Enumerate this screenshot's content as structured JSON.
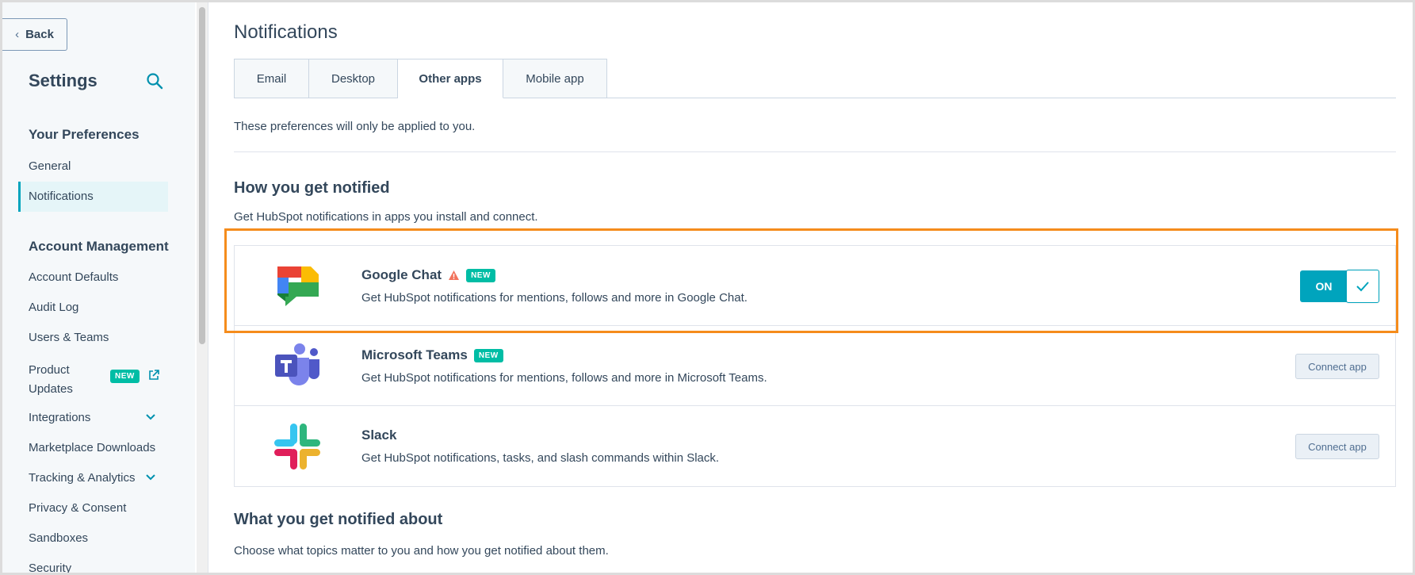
{
  "sidebar": {
    "back_label": "Back",
    "title": "Settings",
    "sections": [
      {
        "heading": "Your Preferences",
        "items": [
          "General",
          "Notifications"
        ]
      },
      {
        "heading": "Account Management",
        "items": [
          "Account Defaults",
          "Audit Log",
          "Users & Teams",
          "Product Updates",
          "Integrations",
          "Marketplace Downloads",
          "Tracking & Analytics",
          "Privacy & Consent",
          "Sandboxes",
          "Security"
        ]
      }
    ],
    "product_updates_line1": "Product",
    "product_updates_line2": "Updates",
    "new_badge": "NEW",
    "active_item": "Notifications"
  },
  "main": {
    "title": "Notifications",
    "tabs": [
      {
        "label": "Email"
      },
      {
        "label": "Desktop"
      },
      {
        "label": "Other apps",
        "active": true
      },
      {
        "label": "Mobile app"
      }
    ],
    "pref_note": "These preferences will only be applied to you.",
    "how_heading": "How you get notified",
    "how_sub": "Get HubSpot notifications in apps you install and connect.",
    "apps": [
      {
        "name": "Google Chat",
        "badge": "NEW",
        "warning": true,
        "desc": "Get HubSpot notifications for mentions, follows and more in Google Chat.",
        "state": "ON"
      },
      {
        "name": "Microsoft Teams",
        "badge": "NEW",
        "desc": "Get HubSpot notifications for mentions, follows and more in Microsoft Teams.",
        "action": "Connect app"
      },
      {
        "name": "Slack",
        "desc": "Get HubSpot notifications, tasks, and slash commands within Slack.",
        "action": "Connect app"
      }
    ],
    "what_heading": "What you get notified about",
    "what_sub": "Choose what topics matter to you and how you get notified about them."
  },
  "colors": {
    "accent": "#00a4bd",
    "badge": "#00bda5",
    "highlight": "#f58c1c",
    "text": "#33475b"
  }
}
